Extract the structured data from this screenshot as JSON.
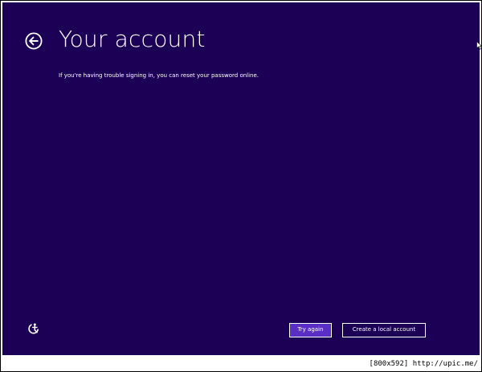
{
  "page": {
    "title": "Your account",
    "message": "If you're having trouble signing in, you can reset your password online."
  },
  "buttons": {
    "try_again": "Try again",
    "create_local_account": "Create a local account"
  },
  "icons": {
    "back": "back-arrow-circle-icon",
    "ease_of_access": "ease-of-access-icon",
    "cursor": "mouse-pointer-icon"
  },
  "colors": {
    "background": "#1b0055",
    "primary_button": "#5a2dc4",
    "text": "#ffffff"
  },
  "caption": "[800x592] http://upic.me/"
}
